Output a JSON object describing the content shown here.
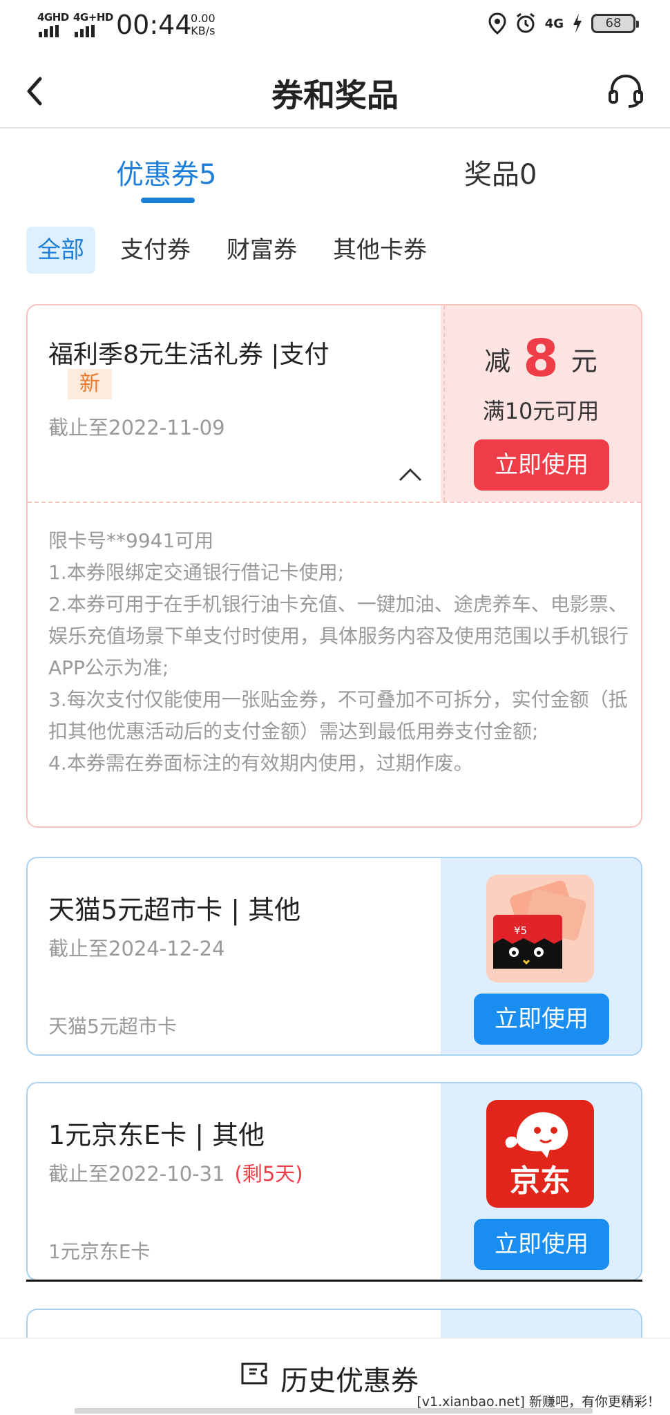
{
  "status_bar": {
    "signal1": "4GHD",
    "signal2": "4G+HD",
    "time": "00:44",
    "speed_value": "0.00",
    "speed_unit": "KB/s",
    "network": "4G",
    "battery": "68"
  },
  "header": {
    "title": "券和奖品"
  },
  "tabs": [
    {
      "label": "优惠券5",
      "active": true
    },
    {
      "label": "奖品0",
      "active": false
    }
  ],
  "filters": [
    {
      "label": "全部",
      "active": true
    },
    {
      "label": "支付券",
      "active": false
    },
    {
      "label": "财富券",
      "active": false
    },
    {
      "label": "其他卡券",
      "active": false
    }
  ],
  "coupons": [
    {
      "title": "福利季8元生活礼券 |支付",
      "badge": "新",
      "expiry": "截止至2022-11-09",
      "reduce_label": "减",
      "amount": "8",
      "unit": "元",
      "condition": "满10元可用",
      "button": "立即使用",
      "details": [
        "限卡号**9941可用",
        "1.本券限绑定交通银行借记卡使用;",
        "2.本券可用于在手机银行油卡充值、一键加油、途虎养车、电影票、娱乐充值场景下单支付时使用，具体服务内容及使用范围以手机银行APP公示为准;",
        "3.每次支付仅能使用一张贴金券，不可叠加不可拆分，实付金额（抵扣其他优惠活动后的支付金额）需达到最低用券支付金额;",
        "4.本券需在券面标注的有效期内使用，过期作废。"
      ],
      "accent": "#ee3d48"
    },
    {
      "title": "天猫5元超市卡 | 其他",
      "expiry": "截止至2024-12-24",
      "subtitle": "天猫5元超市卡",
      "image_text": "¥5",
      "button": "立即使用",
      "accent": "#1a8ef0"
    },
    {
      "title": "1元京东E卡 | 其他",
      "expiry": "截止至2022-10-31",
      "remaining": "(剩5天)",
      "subtitle": "1元京东E卡",
      "image_text": "京东",
      "button": "立即使用",
      "accent": "#1a8ef0"
    }
  ],
  "bottom": {
    "history_label": "历史优惠券",
    "watermark": "[v1.xianbao.net] 新赚吧，有你更精彩！"
  }
}
